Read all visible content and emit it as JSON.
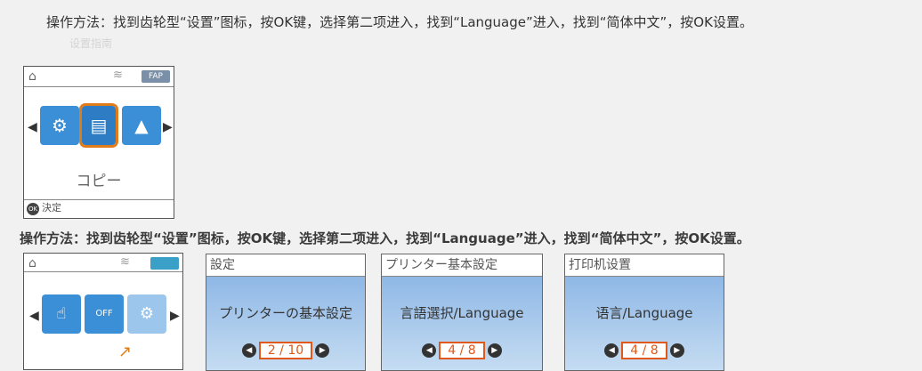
{
  "instructions": {
    "top": "操作方法：找到齿轮型“设置”图标，按OK键，选择第二项进入，找到“Language”进入，找到“简体中文”，按OK设置。",
    "faded": "设置指南",
    "bottom": "操作方法：找到齿轮型“设置”图标，按OK键，选择第二项进入，找到“Language”进入，找到“简体中文”，按OK设置。"
  },
  "panel1": {
    "status_tag": "FAP",
    "caption": "コピー",
    "ok_key": "OK",
    "ok_label": "決定"
  },
  "panel2": {
    "off_label": "OFF"
  },
  "screens": [
    {
      "title": "設定",
      "item": "プリンターの基本設定",
      "page": "2 / 10"
    },
    {
      "title": "プリンター基本設定",
      "item": "言語選択/Language",
      "page": "4 / 8"
    },
    {
      "title": "打印机设置",
      "item": "语言/Language",
      "page": "4 / 8"
    }
  ]
}
